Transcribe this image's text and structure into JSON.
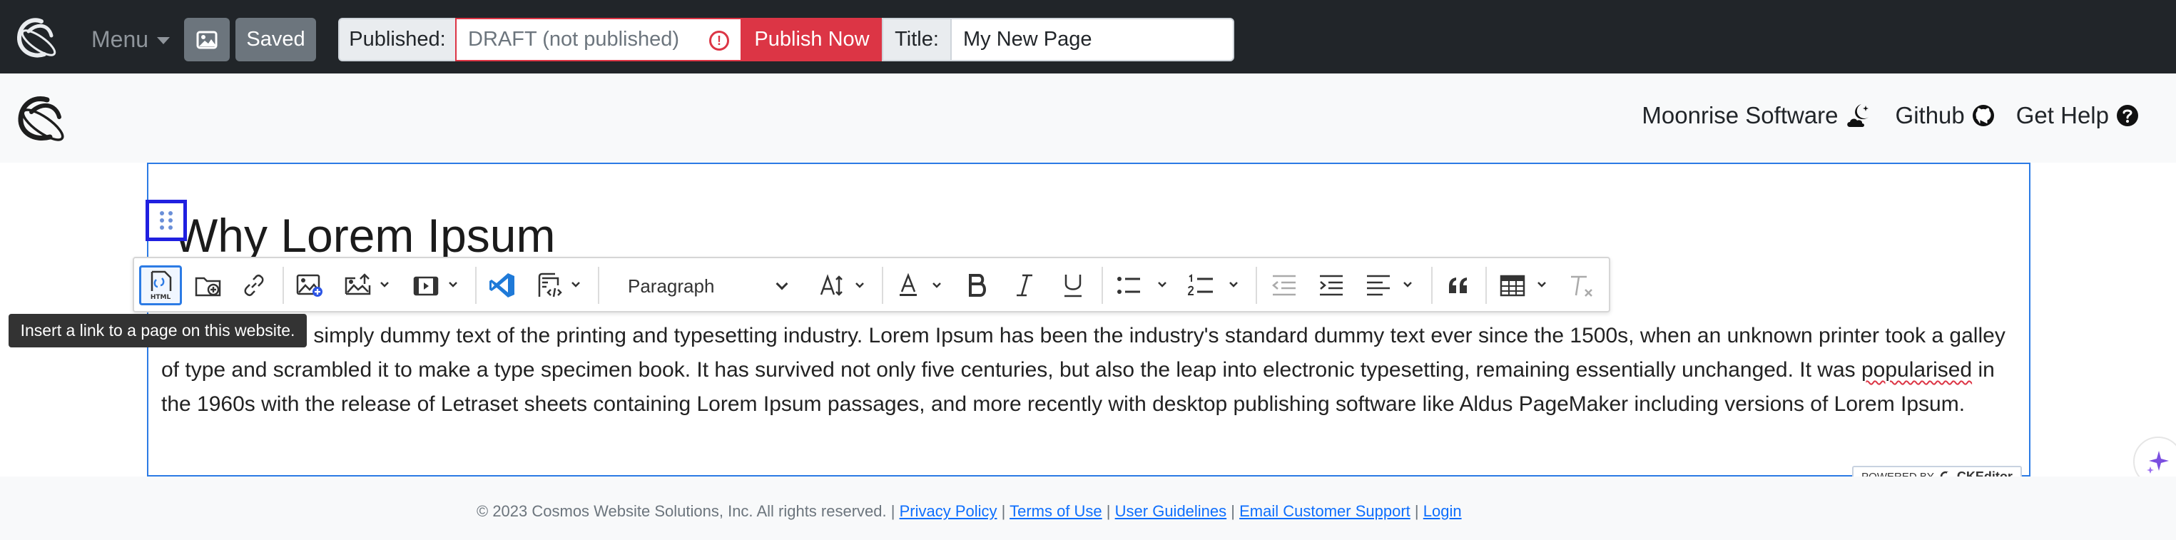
{
  "topbar": {
    "menu_label": "Menu",
    "saved_label": "Saved",
    "published_label": "Published:",
    "published_value": "DRAFT (not published)",
    "alert_glyph": "!",
    "publish_now_label": "Publish Now",
    "title_label": "Title:",
    "title_value": "My New Page"
  },
  "nav": {
    "items": [
      {
        "label": "Moonrise Software",
        "icon": "moon-cloud-icon"
      },
      {
        "label": "Github",
        "icon": "github-icon"
      },
      {
        "label": "Get Help",
        "icon": "question-circle-icon"
      }
    ]
  },
  "content": {
    "heading": "Why Lorem Ipsum",
    "paragraph_pre": "Lorem Ipsum is simply dummy text of the printing and typesetting industry. Lorem Ipsum has been the industry's standard dummy text ever since the 1500s, when an unknown printer took a galley of type and scrambled it to make a type specimen book. It has survived not only five centuries, but also the leap into electronic typesetting, remaining essentially unchanged. It was ",
    "paragraph_misspelled": "popularised",
    "paragraph_post": " in the 1960s with the release of Letraset sheets containing Lorem Ipsum passages, and more recently with desktop publishing software like Aldus PageMaker including versions of Lorem Ipsum."
  },
  "toolbar": {
    "paragraph_style": "Paragraph",
    "tooltip": "Insert a link to a page on this website.",
    "icons": [
      "html-page-link-icon",
      "folder-add-icon",
      "link-icon",
      "insert-image-icon",
      "upload-image-icon",
      "media-embed-icon",
      "vscode-icon",
      "code-block-icon",
      "font-size-icon",
      "font-color-icon",
      "bold-icon",
      "italic-icon",
      "underline-icon",
      "bulleted-list-icon",
      "numbered-list-icon",
      "outdent-icon",
      "indent-icon",
      "align-icon",
      "block-quote-icon",
      "table-icon",
      "remove-format-icon"
    ]
  },
  "badge": {
    "powered_by": "POWERED BY",
    "brand": "CKEditor"
  },
  "footer": {
    "copyright": "© 2023 Cosmos Website Solutions, Inc. All rights reserved.",
    "separator": "|",
    "links": [
      "Privacy Policy",
      "Terms of Use",
      "User Guidelines",
      "Email Customer Support",
      "Login"
    ]
  },
  "colors": {
    "topbar_bg": "#212529",
    "danger": "#dc3545",
    "accent": "#2c7be5",
    "link": "#0d6efd"
  }
}
